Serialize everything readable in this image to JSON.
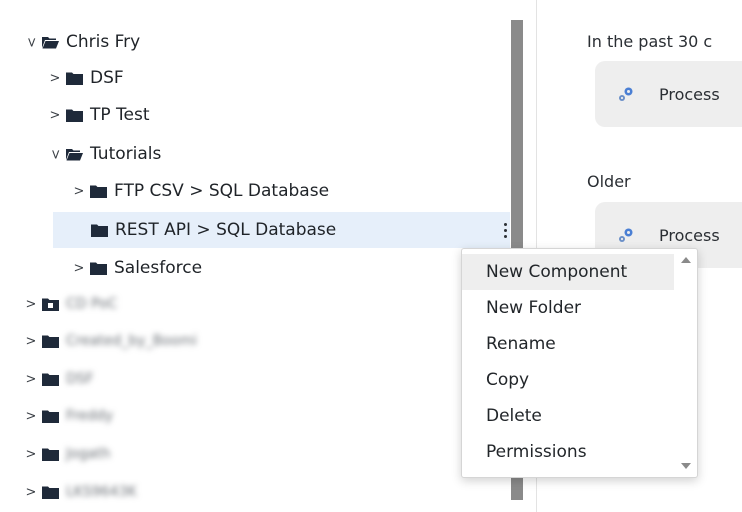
{
  "colors": {
    "folder": "#1f2a3a",
    "selected_row": "#e6effa",
    "divider": "#8a8a8a",
    "card": "#eeeeee",
    "gear": "#4a7fd4",
    "menu_hover": "#eeeeee"
  },
  "tree": {
    "root": {
      "label": "Chris Fry",
      "icon": "folder-open-icon",
      "expanded": true
    },
    "items": [
      {
        "label": "DSF",
        "icon": "folder-icon",
        "expanded": false
      },
      {
        "label": "TP Test",
        "icon": "folder-icon",
        "expanded": false
      },
      {
        "label": "Tutorials",
        "icon": "folder-open-icon",
        "expanded": true
      },
      {
        "label": "FTP CSV > SQL Database",
        "icon": "folder-icon",
        "expanded": false
      },
      {
        "label": "REST API > SQL Database",
        "icon": "folder-icon",
        "selected": true
      },
      {
        "label": "Salesforce",
        "icon": "folder-icon",
        "expanded": false
      }
    ],
    "blurred_items": [
      {
        "label": "CD PoC",
        "icon": "folder-badge-icon"
      },
      {
        "label": "Created_by_Boomi",
        "icon": "folder-icon"
      },
      {
        "label": "DSF",
        "icon": "folder-icon"
      },
      {
        "label": "Freddy",
        "icon": "folder-icon"
      },
      {
        "label": "Jogath",
        "icon": "folder-icon"
      },
      {
        "label": "LKS9643K",
        "icon": "folder-icon"
      }
    ]
  },
  "recent": {
    "past30_label": "In the past 30 c",
    "older_label": "Older",
    "card1_text": "Process",
    "card2_text": "Process",
    "card_icon": "gear-process-icon"
  },
  "context_menu": {
    "items": [
      {
        "label": "New Component",
        "hover": true
      },
      {
        "label": "New Folder"
      },
      {
        "label": "Rename"
      },
      {
        "label": "Copy"
      },
      {
        "label": "Delete"
      },
      {
        "label": "Permissions"
      }
    ]
  }
}
